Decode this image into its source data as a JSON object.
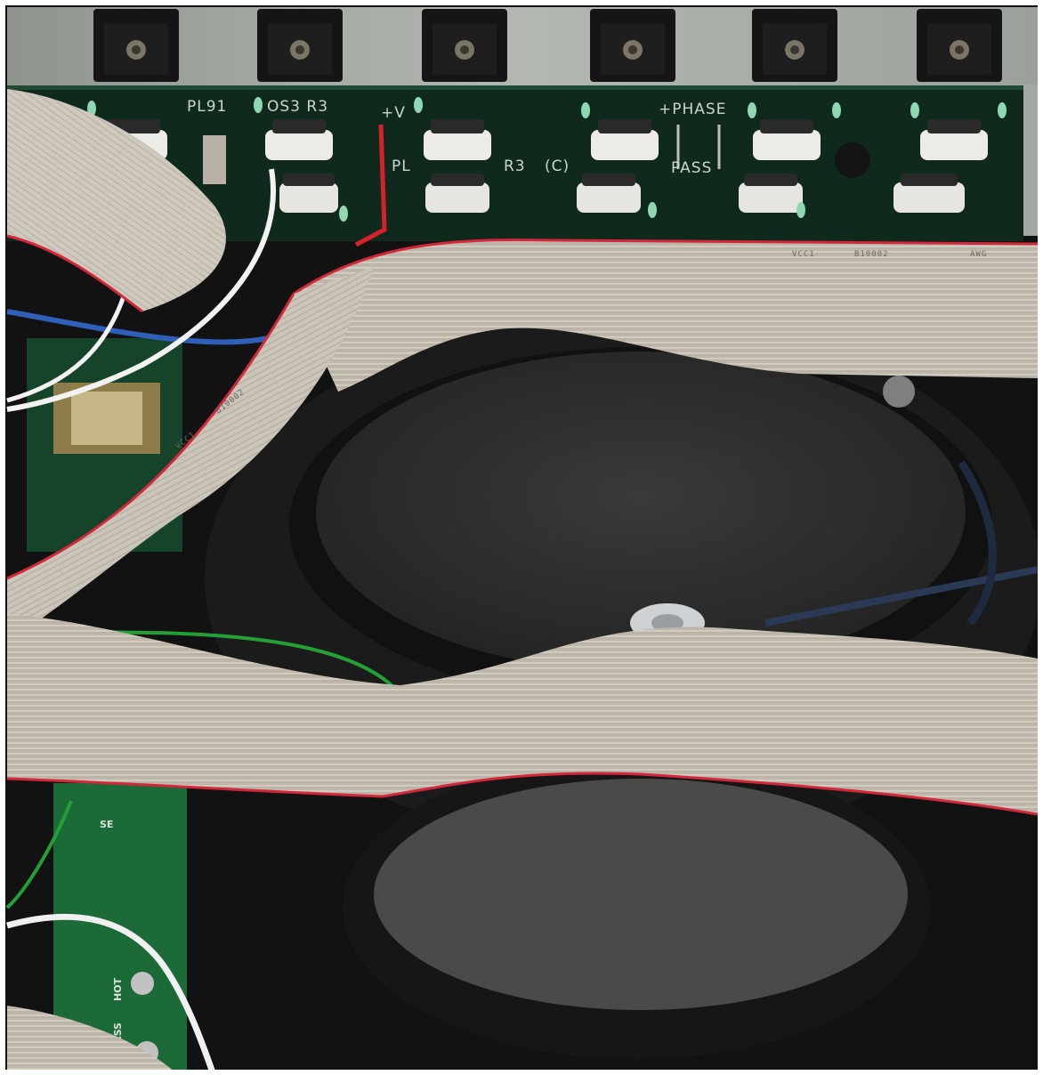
{
  "photo": {
    "subject": "amplifier-interior"
  },
  "pcb_labels": {
    "top_left": "PL91",
    "top_middle": "OS3 R3",
    "supply": "+V",
    "phase": "+PHASE",
    "second_row": "PL",
    "second_row_ref": "R3",
    "second_row_c": "(C)",
    "pass": "PASS",
    "side_se": "SE",
    "side_hot": "HOT",
    "side_pass": "PASS"
  },
  "cable_prints": {
    "upper": [
      "VCC1",
      "B10002",
      "AWG"
    ],
    "diagonal": [
      "VCC1",
      "B10002"
    ]
  },
  "colors": {
    "pcb": "#0f2a1d",
    "heatsink": "#9da39d",
    "ribbon": "#c9c3b8",
    "ribbon_edge": "#d2283a",
    "transformer_pad": "#2e2e2e",
    "wire_red": "#d8202b",
    "wire_green": "#22a036",
    "wire_blue": "#2f5fb8",
    "wire_white": "#f2f2f2"
  },
  "icons": {
    "power_transistor": "transistor-to220-icon",
    "resistor": "ceramic-resistor-icon",
    "led": "led-icon",
    "screw": "screw-icon"
  }
}
